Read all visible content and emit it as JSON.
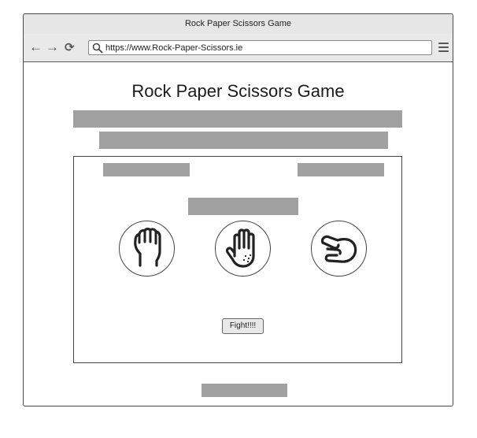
{
  "window": {
    "title": "Rock Paper Scissors Game"
  },
  "toolbar": {
    "back_icon": "arrow-left-icon",
    "forward_icon": "arrow-right-icon",
    "reload_icon": "reload-icon",
    "url": "https://www.Rock-Paper-Scissors.ie",
    "menu_icon": "hamburger-menu-icon"
  },
  "page": {
    "title": "Rock Paper Scissors Game",
    "placeholder_color": "#a1a1a1"
  },
  "game": {
    "choices": [
      {
        "name": "rock",
        "icon": "rock-fist-icon"
      },
      {
        "name": "paper",
        "icon": "paper-hand-icon"
      },
      {
        "name": "scissors",
        "icon": "scissors-hand-icon"
      }
    ],
    "fight_label": "Fight!!!!"
  }
}
